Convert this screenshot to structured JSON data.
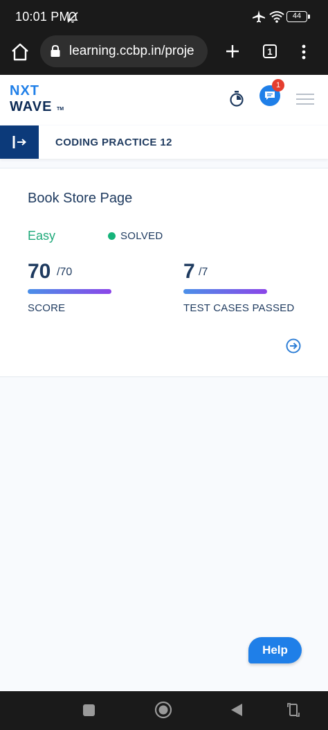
{
  "status_bar": {
    "time": "10:01 PM",
    "battery": "44",
    "icons": [
      "bell-off-icon",
      "airplane-icon",
      "wifi-icon",
      "battery-icon"
    ]
  },
  "browser": {
    "url": "learning.ccbp.in/proje",
    "tab_count": "1",
    "icons": [
      "home-icon",
      "lock-icon",
      "new-tab-plus-icon",
      "tabs-icon",
      "more-vert-icon"
    ]
  },
  "header": {
    "logo_line1": "NXT",
    "logo_line2": "WAVE",
    "logo_tm": "TM",
    "notification_count": "1",
    "icons": [
      "stopwatch-icon",
      "chat-icon",
      "menu-icon"
    ]
  },
  "practice": {
    "title": "CODING PRACTICE 12"
  },
  "card": {
    "title": "Book Store Page",
    "difficulty": "Easy",
    "status": "SOLVED",
    "score": {
      "value": "70",
      "total": "/70",
      "label": "SCORE",
      "progress": 1.0
    },
    "tests": {
      "value": "7",
      "total": "/7",
      "label": "TEST CASES PASSED",
      "progress": 1.0
    }
  },
  "help": {
    "label": "Help"
  },
  "colors": {
    "brand_blue": "#0c3a7a",
    "text_navy": "#1e3a5f",
    "easy_green": "#1fa97a",
    "help_blue": "#1f7fe8",
    "progress_start": "#4a8fe8",
    "progress_end": "#8b45e8"
  },
  "nav": {
    "icons": [
      "recents-square-icon",
      "home-circle-icon",
      "back-triangle-icon",
      "rotate-icon"
    ]
  }
}
